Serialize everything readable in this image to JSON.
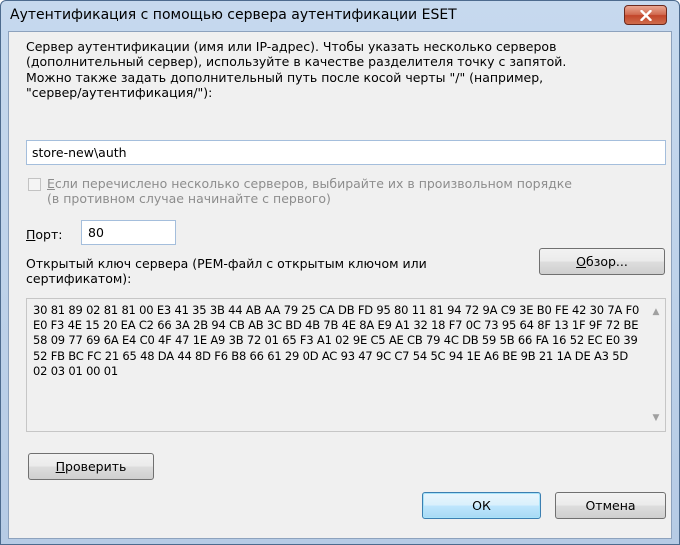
{
  "window": {
    "title": "Аутентификация с помощью сервера аутентификации ESET",
    "close_icon": "close-icon"
  },
  "description": "Сервер аутентификации (имя или IP-адрес). Чтобы указать несколько серверов\n(дополнительный сервер), используйте в качестве разделителя точку с запятой.\nМожно также задать дополнительный путь после косой черты \"/\" (например,\n\"сервер/аутентификация/\"):",
  "server": {
    "value": "store-new\\auth"
  },
  "random_order": {
    "checked": false,
    "enabled": false,
    "label_hotkey": "Е",
    "label_rest": "сли перечислено несколько серверов, выбирайте их в произвольном порядке\n(в противном случае начинайте с первого)"
  },
  "port": {
    "label_hotkey": "П",
    "label_rest": "орт:",
    "value": "80"
  },
  "public_key": {
    "label": "Открытый ключ сервера (PEM-файл с открытым ключом или\nсертификатом):",
    "value": "30 81 89 02 81 81 00 E3 41 35 3B 44 AB AA 79 25 CA DB FD 95 80 11 81 94 72 9A C9 3E B0 FE 42 30 7A F0 E0 F3 4E 15 20 EA C2 66 3A 2B 94 CB AB 3C BD 4B 7B 4E 8A E9 A1 32 18 F7 0C 73 95 64 8F 13 1F 9F 72 BE 58 09 77 69 6A E4 C0 4F 47 1E A9 3B 72 01 65 F3 A1 02 9E C5 AE CB 79 4C DB 59 5B 66 FA 16 52 EC E0 39 52 FB BC FC 21 65 48 DA 44 8D F6 B8 66 61 29 0D AC 93 47 9C C7 54 5C 94 1E A6 BE 9B 21 1A DE A3 5D 02 03 01 00 01"
  },
  "buttons": {
    "browse_hotkey": "О",
    "browse_rest": "бзор...",
    "verify_hotkey": "П",
    "verify_rest": "роверить",
    "ok": "ОК",
    "cancel": "Отмена"
  }
}
